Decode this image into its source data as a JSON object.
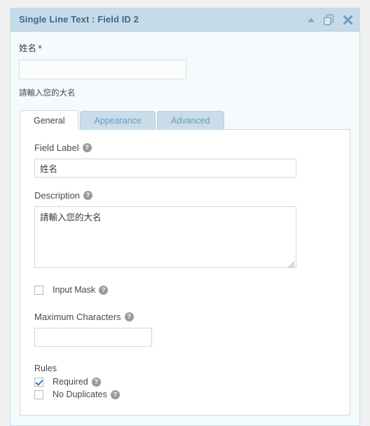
{
  "panel": {
    "header": {
      "title": "Single Line Text : Field ID 2",
      "collapse_icon": "caret-up-icon",
      "duplicate_icon": "duplicate-icon",
      "close_icon": "close-icon",
      "background_color": "#c6dbe8",
      "title_color": "#3d6b8c"
    },
    "preview": {
      "label": "姓名",
      "required_marker": "*",
      "required_marker_color": "#a02020",
      "input_value": "",
      "description": "請輸入您的大名"
    },
    "tabs": [
      {
        "label": "General",
        "active": true
      },
      {
        "label": "Appearance",
        "active": false
      },
      {
        "label": "Advanced",
        "active": false
      }
    ],
    "general_tab": {
      "field_label": {
        "label": "Field Label",
        "help_glyph": "?",
        "value": "姓名",
        "placeholder": ""
      },
      "description": {
        "label": "Description",
        "help_glyph": "?",
        "value": "請輸入您的大名",
        "placeholder": ""
      },
      "input_mask": {
        "label": "Input Mask",
        "help_glyph": "?",
        "checked": false
      },
      "maximum_characters": {
        "label": "Maximum Characters",
        "help_glyph": "?",
        "value": "",
        "placeholder": ""
      },
      "rules": {
        "heading": "Rules",
        "items": [
          {
            "label": "Required",
            "help_glyph": "?",
            "checked": true
          },
          {
            "label": "No Duplicates",
            "help_glyph": "?",
            "checked": false
          }
        ]
      }
    }
  }
}
